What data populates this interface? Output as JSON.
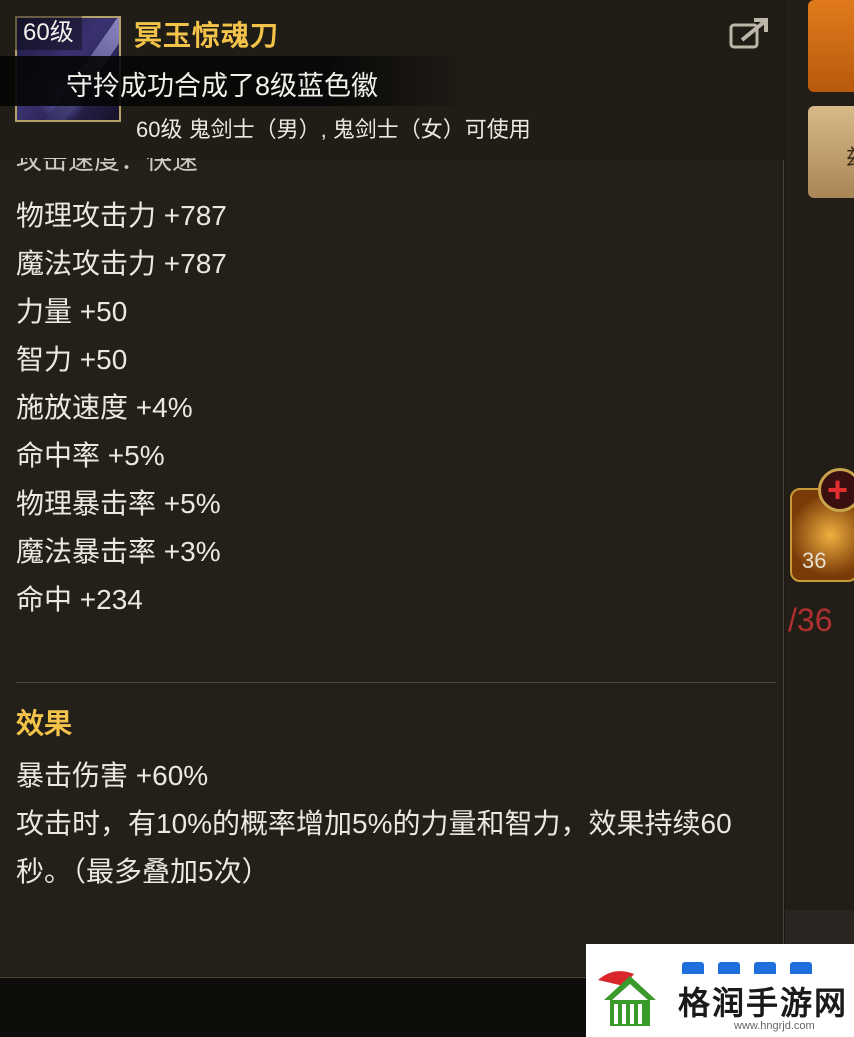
{
  "item": {
    "level_badge": "60级",
    "name": "冥玉惊魂刀",
    "notification": "守拎成功合成了8级蓝色徽",
    "usable_by": "60级 鬼剑士（男）, 鬼剑士（女）可使用",
    "partial_stat": "攻击速度：快速"
  },
  "stats": [
    "物理攻击力 +787",
    "魔法攻击力 +787",
    "力量 +50",
    "智力 +50",
    "施放速度 +4%",
    "命中率 +5%",
    "物理暴击率 +5%",
    "魔法暴击率 +3%",
    "命中 +234"
  ],
  "effect": {
    "title": "效果",
    "lines": [
      "暴击伤害 +60%",
      "攻击时，有10%的概率增加5%的力量和智力，效果持续60秒。（最多叠加5次）"
    ]
  },
  "background": {
    "side_button_glyph": "兹",
    "plus_glyph": "+",
    "gold_slot_count": "36",
    "red_count": "/36"
  },
  "watermark": {
    "title": "格润手游网",
    "url": "www.hngrjd.com"
  },
  "colors": {
    "accent_gold": "#f4c44a",
    "text_main": "#ebe8e2",
    "panel_bg": "#24201a",
    "orange_button": "#e07a1c"
  },
  "icons": [
    "share-icon",
    "item-weapon-icon",
    "plus-icon",
    "watermark-logo"
  ]
}
